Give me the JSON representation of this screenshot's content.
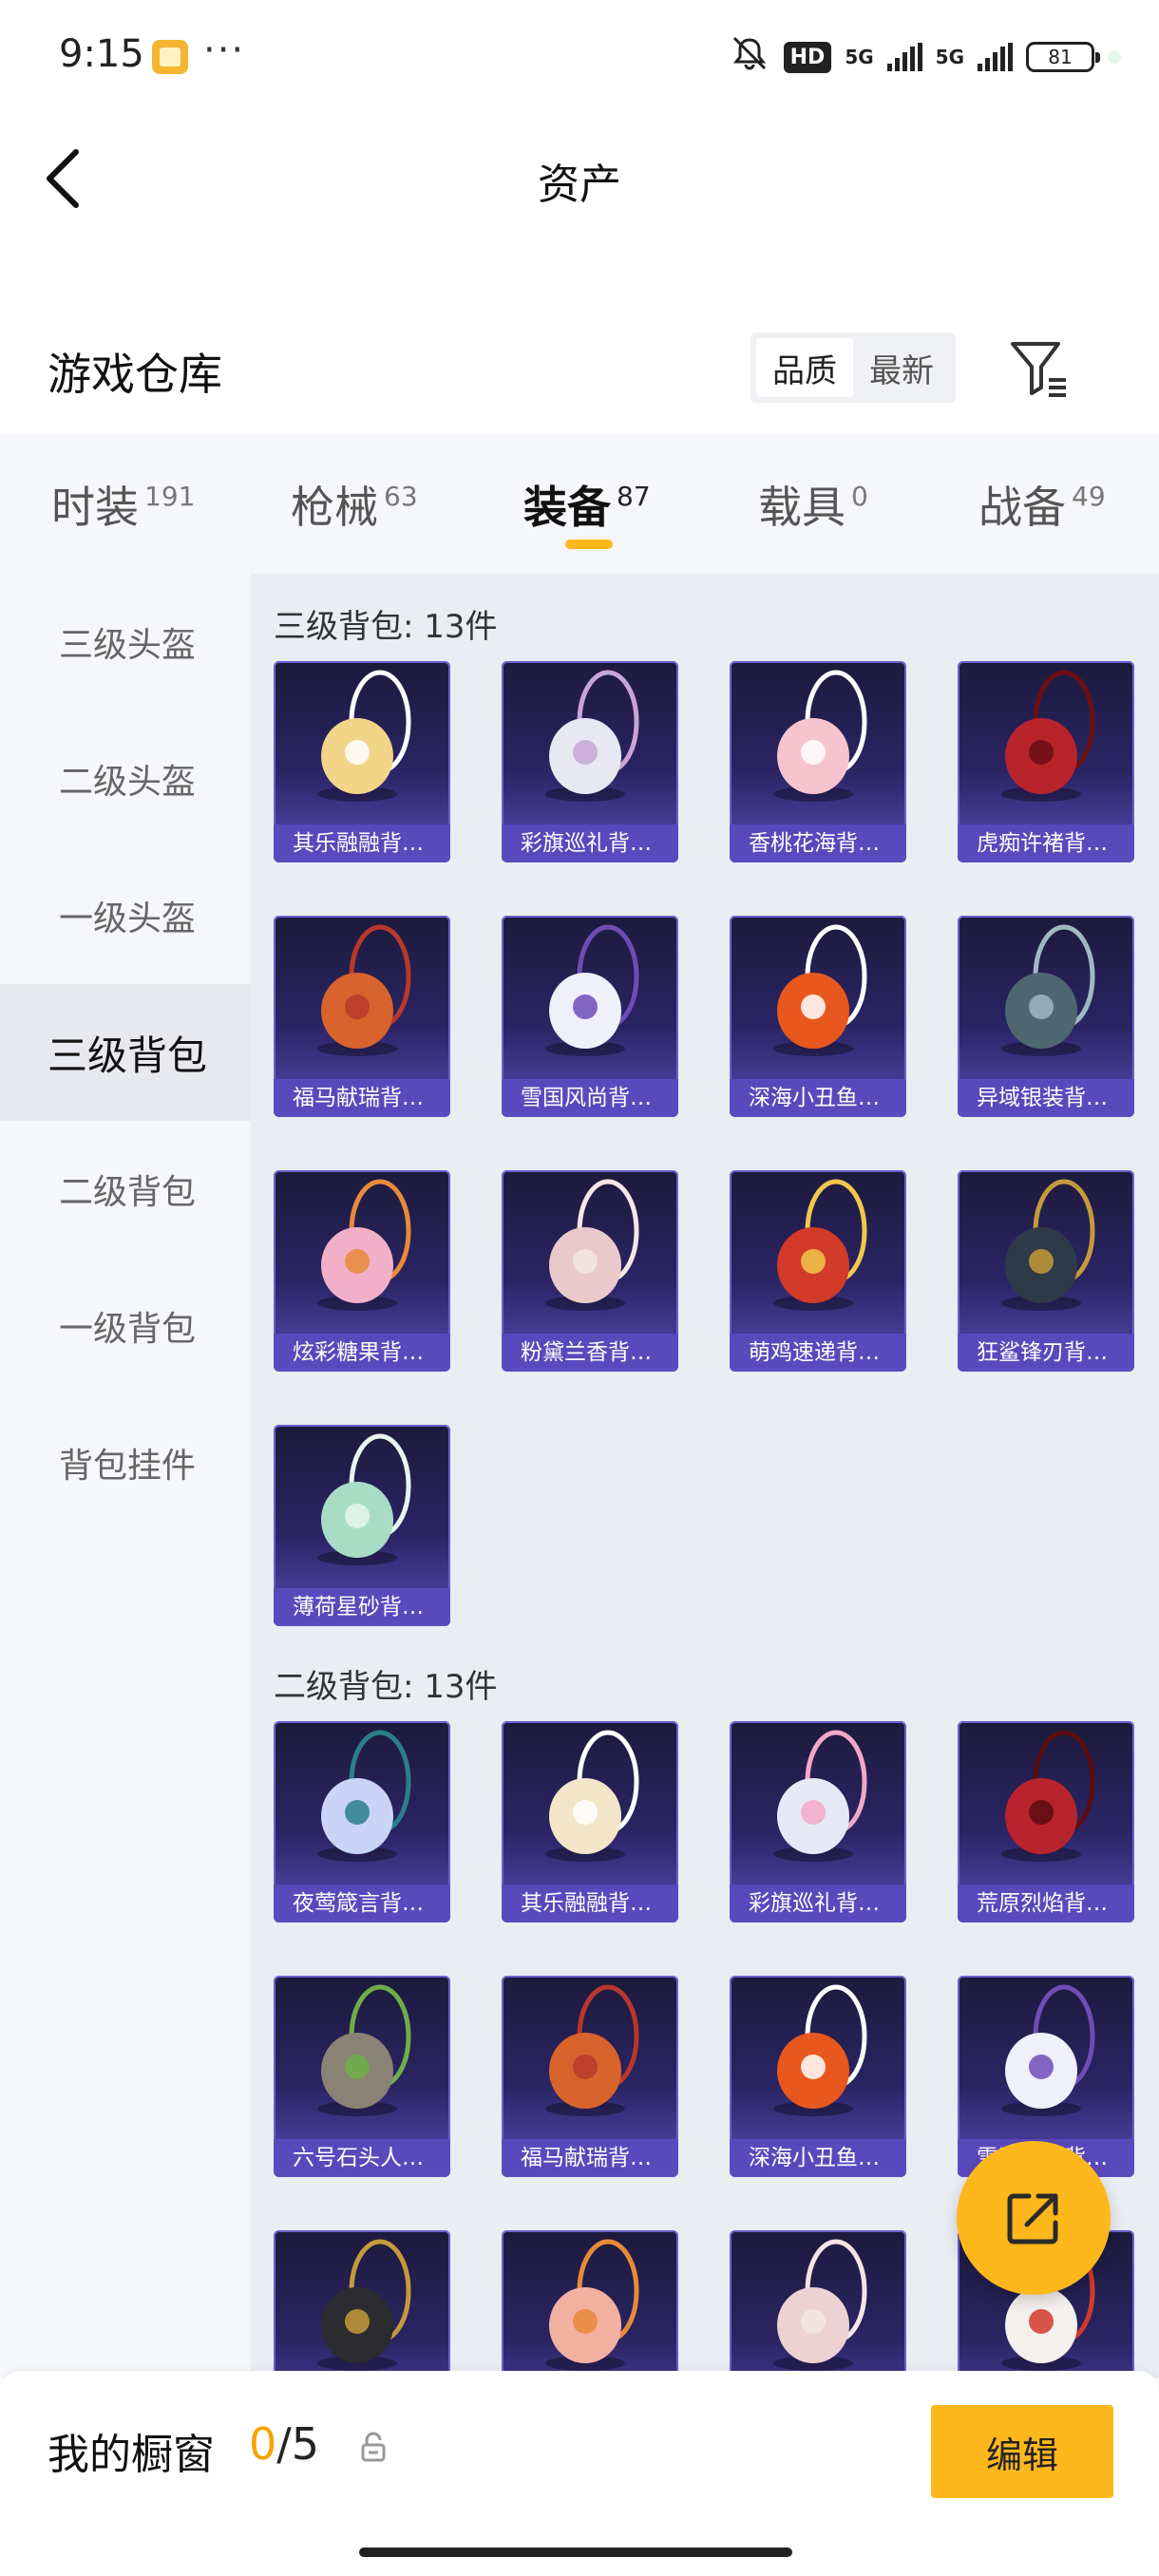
{
  "status_bar": {
    "time": "9:15",
    "battery": "81",
    "hd": "HD",
    "net1": "5G",
    "net2": "5G"
  },
  "header": {
    "title": "资产"
  },
  "warehouse": {
    "title": "游戏仓库",
    "sort_options": [
      "品质",
      "最新"
    ],
    "active_sort": "品质"
  },
  "tabs": [
    {
      "label": "时装",
      "count": "191"
    },
    {
      "label": "枪械",
      "count": "63"
    },
    {
      "label": "装备",
      "count": "87"
    },
    {
      "label": "载具",
      "count": "0"
    },
    {
      "label": "战备",
      "count": "49"
    }
  ],
  "active_tab": "装备",
  "sidebar": [
    {
      "label": "三级头盔"
    },
    {
      "label": "二级头盔"
    },
    {
      "label": "一级头盔"
    },
    {
      "label": "三级背包"
    },
    {
      "label": "二级背包"
    },
    {
      "label": "一级背包"
    },
    {
      "label": "背包挂件"
    }
  ],
  "active_sidebar": "三级背包",
  "groups": [
    {
      "title": "三级背包: 13件",
      "items": [
        {
          "name": "其乐融融背…",
          "accent": "#f3d58a",
          "secondary": "#ffffff"
        },
        {
          "name": "彩旗巡礼背…",
          "accent": "#e8e8f2",
          "secondary": "#c9a4d8"
        },
        {
          "name": "香桃花海背…",
          "accent": "#f6c4cf",
          "secondary": "#ffffff"
        },
        {
          "name": "虎痴许褚背…",
          "accent": "#b8232c",
          "secondary": "#6a0f14"
        },
        {
          "name": "福马献瑞背…",
          "accent": "#d9632c",
          "secondary": "#b8382a"
        },
        {
          "name": "雪国风尚背…",
          "accent": "#f0f0fa",
          "secondary": "#6e4cb8"
        },
        {
          "name": "深海小丑鱼…",
          "accent": "#e8581e",
          "secondary": "#ffffff"
        },
        {
          "name": "异域银装背…",
          "accent": "#4e6670",
          "secondary": "#9fb9c2"
        },
        {
          "name": "炫彩糖果背…",
          "accent": "#f2b0c8",
          "secondary": "#e88a3a"
        },
        {
          "name": "粉黛兰香背…",
          "accent": "#e9c9c9",
          "secondary": "#f5e6e6"
        },
        {
          "name": "萌鸡速递背…",
          "accent": "#d23a2a",
          "secondary": "#f2c84b"
        },
        {
          "name": "狂鲨锋刃背…",
          "accent": "#2d3a48",
          "secondary": "#c49a3a"
        },
        {
          "name": "薄荷星砂背…",
          "accent": "#a9dcc4",
          "secondary": "#e8f6ee"
        }
      ]
    },
    {
      "title": "二级背包: 13件",
      "items": [
        {
          "name": "夜莺箴言背…",
          "accent": "#c9d4f6",
          "secondary": "#2a7f8a"
        },
        {
          "name": "其乐融融背…",
          "accent": "#f3e6c8",
          "secondary": "#ffffff"
        },
        {
          "name": "彩旗巡礼背…",
          "accent": "#e6e8f6",
          "secondary": "#f2a9c8"
        },
        {
          "name": "荒原烈焰背…",
          "accent": "#b8232c",
          "secondary": "#5a0d12"
        },
        {
          "name": "六号石头人…",
          "accent": "#8a8274",
          "secondary": "#6fae4a"
        },
        {
          "name": "福马献瑞背…",
          "accent": "#d9632c",
          "secondary": "#b8382a"
        },
        {
          "name": "深海小丑鱼…",
          "accent": "#e8581e",
          "secondary": "#ffffff"
        },
        {
          "name": "雪国风尚背…",
          "accent": "#f0f0fa",
          "secondary": "#6e4cb8"
        },
        {
          "name": "",
          "accent": "#2b2b30",
          "secondary": "#c49a3a"
        },
        {
          "name": "",
          "accent": "#f2b0a0",
          "secondary": "#e88a3a"
        },
        {
          "name": "",
          "accent": "#ecd2d2",
          "secondary": "#f5e6e6"
        },
        {
          "name": "",
          "accent": "#f4f0ee",
          "secondary": "#d23a2a"
        }
      ]
    }
  ],
  "share_fab": {
    "icon": "share-icon"
  },
  "window": {
    "title": "我的橱窗",
    "count_current": "0",
    "count_total": "/5",
    "edit_label": "编辑"
  },
  "colors": {
    "accent": "#ffb81c",
    "card_gradient_top": "#1d1a3c",
    "card_gradient_bottom": "#5b4bb8"
  }
}
